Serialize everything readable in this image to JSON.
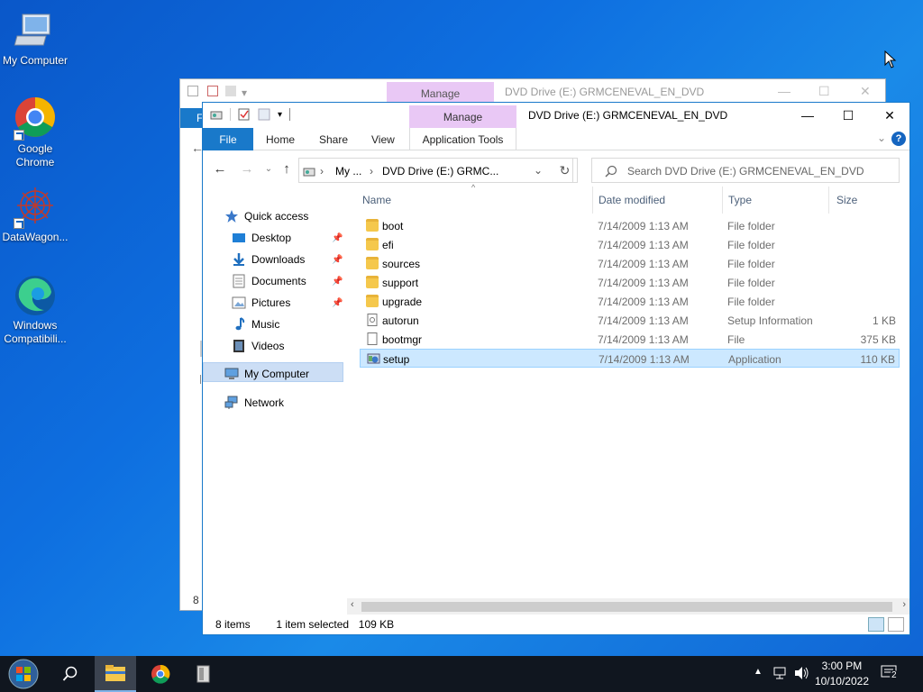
{
  "desktop": {
    "icons": [
      {
        "label": "My Computer",
        "icon": "computer-icon"
      },
      {
        "label": "Google\nChrome",
        "icon": "chrome-icon"
      },
      {
        "label": "DataWagon...",
        "icon": "datawagon-icon"
      },
      {
        "label": "Windows\nCompatibili...",
        "icon": "edge-icon"
      }
    ]
  },
  "back_window": {
    "manage_tab": "Manage",
    "title": "DVD Drive (E:) GRMCENEVAL_EN_DVD",
    "file_tab": "F",
    "status": "8 i"
  },
  "window": {
    "manage_tab": "Manage",
    "title": "DVD Drive (E:) GRMCENEVAL_EN_DVD",
    "ribbon_tabs": [
      "File",
      "Home",
      "Share",
      "View",
      "Application Tools"
    ],
    "address": {
      "crumb1": "My ...",
      "crumb2": "DVD Drive (E:) GRMC..."
    },
    "search_placeholder": "Search DVD Drive (E:) GRMCENEVAL_EN_DVD",
    "nav": {
      "quick_access": "Quick access",
      "items": [
        "Desktop",
        "Downloads",
        "Documents",
        "Pictures",
        "Music",
        "Videos"
      ],
      "my_computer": "My Computer",
      "network": "Network"
    },
    "columns": [
      "Name",
      "Date modified",
      "Type",
      "Size"
    ],
    "files": [
      {
        "name": "boot",
        "date": "7/14/2009 1:13 AM",
        "type": "File folder",
        "size": "",
        "kind": "folder"
      },
      {
        "name": "efi",
        "date": "7/14/2009 1:13 AM",
        "type": "File folder",
        "size": "",
        "kind": "folder"
      },
      {
        "name": "sources",
        "date": "7/14/2009 1:13 AM",
        "type": "File folder",
        "size": "",
        "kind": "folder"
      },
      {
        "name": "support",
        "date": "7/14/2009 1:13 AM",
        "type": "File folder",
        "size": "",
        "kind": "folder"
      },
      {
        "name": "upgrade",
        "date": "7/14/2009 1:13 AM",
        "type": "File folder",
        "size": "",
        "kind": "folder"
      },
      {
        "name": "autorun",
        "date": "7/14/2009 1:13 AM",
        "type": "Setup Information",
        "size": "1 KB",
        "kind": "inf"
      },
      {
        "name": "bootmgr",
        "date": "7/14/2009 1:13 AM",
        "type": "File",
        "size": "375 KB",
        "kind": "file"
      },
      {
        "name": "setup",
        "date": "7/14/2009 1:13 AM",
        "type": "Application",
        "size": "110 KB",
        "kind": "app",
        "selected": true
      }
    ],
    "status": {
      "items": "8 items",
      "selected": "1 item selected",
      "size": "109 KB"
    }
  },
  "taskbar": {
    "time": "3:00 PM",
    "date": "10/10/2022",
    "notification_count": "2"
  }
}
